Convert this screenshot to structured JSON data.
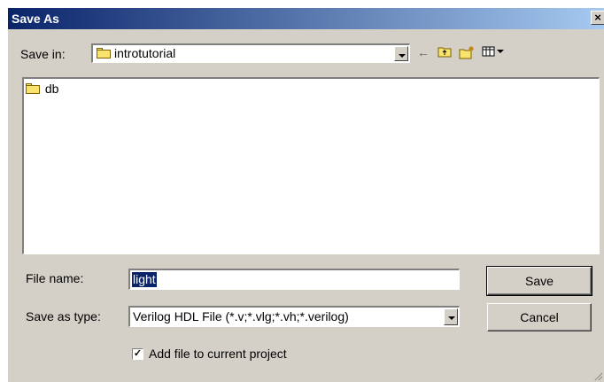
{
  "window": {
    "title": "Save As"
  },
  "save_in": {
    "label": "Save in:",
    "value": "introtutorial"
  },
  "toolbar": {
    "icons": [
      "back-arrow-icon",
      "up-folder-icon",
      "new-folder-icon",
      "view-menu-icon"
    ]
  },
  "file_list": {
    "items": [
      {
        "name": "db",
        "icon": "folder-icon"
      }
    ]
  },
  "file_name": {
    "label": "File name:",
    "value": "light"
  },
  "save_as_type": {
    "label": "Save as type:",
    "value": "Verilog HDL File (*.v;*.vlg;*.vh;*.verilog)"
  },
  "buttons": {
    "save": "Save",
    "cancel": "Cancel"
  },
  "add_to_project": {
    "label": "Add file to current project",
    "checked": true
  },
  "colors": {
    "title_bar_start": "#0a246a",
    "title_bar_end": "#a6caf0",
    "dialog_bg": "#d4d0c8",
    "selection": "#0a246a"
  }
}
